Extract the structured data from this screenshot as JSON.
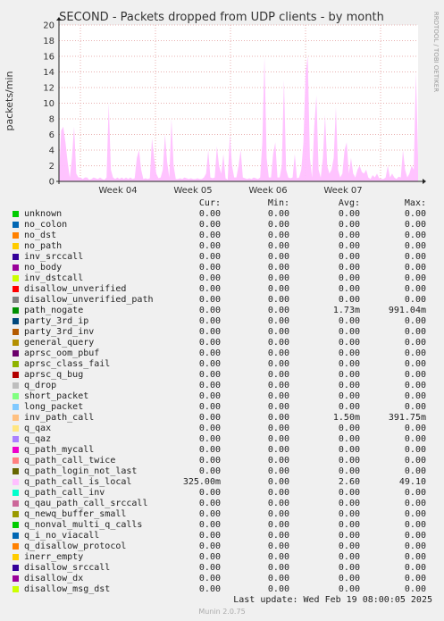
{
  "chart_data": {
    "type": "area",
    "title": "SECOND - Packets dropped from UDP clients - by month",
    "ylabel": "packets/min",
    "ylim": [
      0,
      20
    ],
    "yticks": [
      "0",
      "2",
      "4",
      "6",
      "8",
      "10",
      "12",
      "14",
      "16",
      "18",
      "20"
    ],
    "xticks": [
      "Week 04",
      "Week 05",
      "Week 06",
      "Week 07"
    ],
    "grid": true,
    "series": [
      {
        "name": "q_path_call_is_local",
        "color": "#ffc0ff",
        "values": [
          0.5,
          6.5,
          7.0,
          5.0,
          2.5,
          0.5,
          3.0,
          7.0,
          1.0,
          0.5,
          0.5,
          0.3,
          0.5,
          0.5,
          0.2,
          0.3,
          0.5,
          0.4,
          0.3,
          0.5,
          0.3,
          0.2,
          0.5,
          10.0,
          1.5,
          0.5,
          0.3,
          0.5,
          0.3,
          0.5,
          0.3,
          0.5,
          0.3,
          0.5,
          0.3,
          0.4,
          3.0,
          4.0,
          1.5,
          0.3,
          0.4,
          0.3,
          0.4,
          5.5,
          3.0,
          1.0,
          0.4,
          0.5,
          1.5,
          6.0,
          2.5,
          0.5,
          8.0,
          2.0,
          0.3,
          0.3,
          0.4,
          0.3,
          0.5,
          0.4,
          0.3,
          0.4,
          0.3,
          0.3,
          0.4,
          0.3,
          0.3,
          0.5,
          1.0,
          4.0,
          0.5,
          0.4,
          0.5,
          4.5,
          2.0,
          1.0,
          3.5,
          0.4,
          0.2,
          6.0,
          2.0,
          0.5,
          0.5,
          2.0,
          4.0,
          0.5,
          0.4,
          0.3,
          0.4,
          0.3,
          0.5,
          0.4,
          0.3,
          0.5,
          5.0,
          16.0,
          3.0,
          0.5,
          0.5,
          3.5,
          5.0,
          0.5,
          0.5,
          2.0,
          13.0,
          1.5,
          0.5,
          0.4,
          0.5,
          3.5,
          0.4,
          0.5,
          1.5,
          5.0,
          14.0,
          16.0,
          3.0,
          0.5,
          7.0,
          11.0,
          1.5,
          0.5,
          3.0,
          8.5,
          2.0,
          1.0,
          1.5,
          3.0,
          9.5,
          1.5,
          0.5,
          1.0,
          4.0,
          5.0,
          1.0,
          3.0,
          1.0,
          0.5,
          1.5,
          2.0,
          1.2,
          1.0,
          1.5,
          0.5,
          0.3,
          0.8,
          0.5,
          1.0,
          0.4,
          0.3,
          0.3,
          0.5,
          2.0,
          0.5,
          1.0,
          0.5,
          0.3,
          0.6,
          0.5,
          4.0,
          1.5,
          0.5,
          1.0,
          2.0,
          1.5,
          14.0,
          3.0
        ]
      }
    ]
  },
  "legend": {
    "headers": {
      "cur": "Cur:",
      "min": "Min:",
      "avg": "Avg:",
      "max": "Max:"
    },
    "rows": [
      {
        "name": "unknown",
        "color": "#00cc00",
        "cur": "0.00",
        "min": "0.00",
        "avg": "0.00",
        "max": "0.00"
      },
      {
        "name": "no_colon",
        "color": "#0066b3",
        "cur": "0.00",
        "min": "0.00",
        "avg": "0.00",
        "max": "0.00"
      },
      {
        "name": "no_dst",
        "color": "#ff8000",
        "cur": "0.00",
        "min": "0.00",
        "avg": "0.00",
        "max": "0.00"
      },
      {
        "name": "no_path",
        "color": "#ffcc00",
        "cur": "0.00",
        "min": "0.00",
        "avg": "0.00",
        "max": "0.00"
      },
      {
        "name": "inv_srccall",
        "color": "#330099",
        "cur": "0.00",
        "min": "0.00",
        "avg": "0.00",
        "max": "0.00"
      },
      {
        "name": "no_body",
        "color": "#990099",
        "cur": "0.00",
        "min": "0.00",
        "avg": "0.00",
        "max": "0.00"
      },
      {
        "name": "inv_dstcall",
        "color": "#ccff00",
        "cur": "0.00",
        "min": "0.00",
        "avg": "0.00",
        "max": "0.00"
      },
      {
        "name": "disallow_unverified",
        "color": "#ff0000",
        "cur": "0.00",
        "min": "0.00",
        "avg": "0.00",
        "max": "0.00"
      },
      {
        "name": "disallow_unverified_path",
        "color": "#808080",
        "cur": "0.00",
        "min": "0.00",
        "avg": "0.00",
        "max": "0.00"
      },
      {
        "name": "path_nogate",
        "color": "#008f00",
        "cur": "0.00",
        "min": "0.00",
        "avg": "1.73m",
        "max": "991.04m"
      },
      {
        "name": "party_3rd_ip",
        "color": "#00487d",
        "cur": "0.00",
        "min": "0.00",
        "avg": "0.00",
        "max": "0.00"
      },
      {
        "name": "party_3rd_inv",
        "color": "#b35a00",
        "cur": "0.00",
        "min": "0.00",
        "avg": "0.00",
        "max": "0.00"
      },
      {
        "name": "general_query",
        "color": "#b38f00",
        "cur": "0.00",
        "min": "0.00",
        "avg": "0.00",
        "max": "0.00"
      },
      {
        "name": "aprsc_oom_pbuf",
        "color": "#6b006b",
        "cur": "0.00",
        "min": "0.00",
        "avg": "0.00",
        "max": "0.00"
      },
      {
        "name": "aprsc_class_fail",
        "color": "#8fb300",
        "cur": "0.00",
        "min": "0.00",
        "avg": "0.00",
        "max": "0.00"
      },
      {
        "name": "aprsc_q_bug",
        "color": "#b30000",
        "cur": "0.00",
        "min": "0.00",
        "avg": "0.00",
        "max": "0.00"
      },
      {
        "name": "q_drop",
        "color": "#bebebe",
        "cur": "0.00",
        "min": "0.00",
        "avg": "0.00",
        "max": "0.00"
      },
      {
        "name": "short_packet",
        "color": "#80ff80",
        "cur": "0.00",
        "min": "0.00",
        "avg": "0.00",
        "max": "0.00"
      },
      {
        "name": "long_packet",
        "color": "#80c9ff",
        "cur": "0.00",
        "min": "0.00",
        "avg": "0.00",
        "max": "0.00"
      },
      {
        "name": "inv_path_call",
        "color": "#ffc080",
        "cur": "0.00",
        "min": "0.00",
        "avg": "1.50m",
        "max": "391.75m"
      },
      {
        "name": "q_qax",
        "color": "#ffe680",
        "cur": "0.00",
        "min": "0.00",
        "avg": "0.00",
        "max": "0.00"
      },
      {
        "name": "q_qaz",
        "color": "#aa80ff",
        "cur": "0.00",
        "min": "0.00",
        "avg": "0.00",
        "max": "0.00"
      },
      {
        "name": "q_path_mycall",
        "color": "#ee00cc",
        "cur": "0.00",
        "min": "0.00",
        "avg": "0.00",
        "max": "0.00"
      },
      {
        "name": "q_path_call_twice",
        "color": "#ff8080",
        "cur": "0.00",
        "min": "0.00",
        "avg": "0.00",
        "max": "0.00"
      },
      {
        "name": "q_path_login_not_last",
        "color": "#666600",
        "cur": "0.00",
        "min": "0.00",
        "avg": "0.00",
        "max": "0.00"
      },
      {
        "name": "q_path_call_is_local",
        "color": "#ffbfff",
        "cur": "325.00m",
        "min": "0.00",
        "avg": "2.60",
        "max": "49.10"
      },
      {
        "name": "q_path_call_inv",
        "color": "#00ffcc",
        "cur": "0.00",
        "min": "0.00",
        "avg": "0.00",
        "max": "0.00"
      },
      {
        "name": "q_qau_path_call_srccall",
        "color": "#cc6699",
        "cur": "0.00",
        "min": "0.00",
        "avg": "0.00",
        "max": "0.00"
      },
      {
        "name": "q_newq_buffer_small",
        "color": "#999900",
        "cur": "0.00",
        "min": "0.00",
        "avg": "0.00",
        "max": "0.00"
      },
      {
        "name": "q_nonval_multi_q_calls",
        "color": "#00cc00",
        "cur": "0.00",
        "min": "0.00",
        "avg": "0.00",
        "max": "0.00"
      },
      {
        "name": "q_i_no_viacall",
        "color": "#0066b3",
        "cur": "0.00",
        "min": "0.00",
        "avg": "0.00",
        "max": "0.00"
      },
      {
        "name": "q_disallow_protocol",
        "color": "#ff8000",
        "cur": "0.00",
        "min": "0.00",
        "avg": "0.00",
        "max": "0.00"
      },
      {
        "name": "inerr_empty",
        "color": "#ffcc00",
        "cur": "0.00",
        "min": "0.00",
        "avg": "0.00",
        "max": "0.00"
      },
      {
        "name": "disallow_srccall",
        "color": "#330099",
        "cur": "0.00",
        "min": "0.00",
        "avg": "0.00",
        "max": "0.00"
      },
      {
        "name": "disallow_dx",
        "color": "#990099",
        "cur": "0.00",
        "min": "0.00",
        "avg": "0.00",
        "max": "0.00"
      },
      {
        "name": "disallow_msg_dst",
        "color": "#ccff00",
        "cur": "0.00",
        "min": "0.00",
        "avg": "0.00",
        "max": "0.00"
      }
    ]
  },
  "last_update": "Last update: Wed Feb 19 08:00:05 2025",
  "side_label": "RRDTOOL / TOBI OETIKER",
  "footer": "Munin 2.0.75"
}
